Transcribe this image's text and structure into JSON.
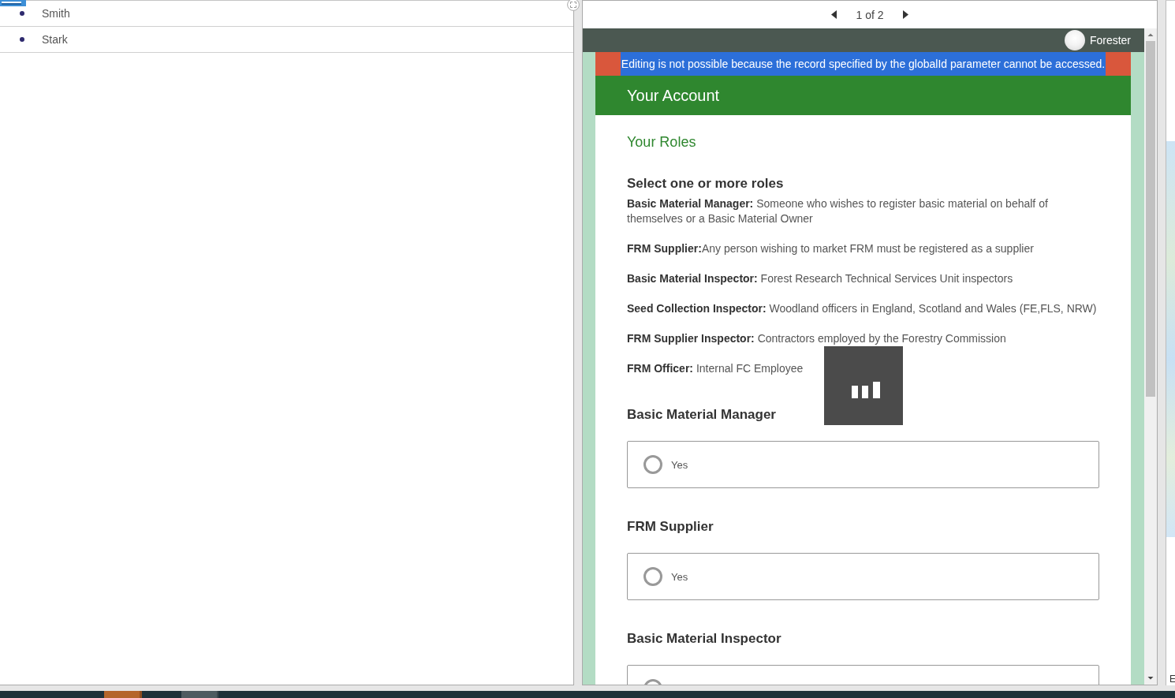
{
  "list_panel": {
    "items": [
      {
        "label": "Smith"
      },
      {
        "label": "Stark"
      }
    ]
  },
  "pager": {
    "text": "1 of 2"
  },
  "form": {
    "header": {
      "user": "Forester"
    },
    "error_banner": {
      "text": "Editing is not possible because the record specified by the globalId parameter cannot be accessed.",
      "highlighted": true
    },
    "title": "Your Account",
    "section_title": "Your Roles",
    "question": "Select one or more roles",
    "role_descriptions": [
      "**Basic Material Manager:** Someone who wishes to register basic material on behalf of themselves or a Basic Material Owner",
      "**FRM Supplier:**Any person wishing to market FRM must be registered as a supplier",
      "**Basic Material Inspector:** Forest Research Technical Services Unit inspectors",
      "**Seed Collection Inspector:** Woodland officers in England, Scotland and Wales (FE,FLS, NRW)",
      "**FRM Supplier Inspector:** Contractors employed by the Forestry Commission",
      "**FRM Officer:** Internal FC Employee"
    ],
    "fields": [
      {
        "label": "Basic Material Manager",
        "options": [
          {
            "label": "Yes",
            "selected": false
          }
        ]
      },
      {
        "label": "FRM Supplier",
        "options": [
          {
            "label": "Yes",
            "selected": false
          }
        ]
      },
      {
        "label": "Basic Material Inspector",
        "options": [
          {
            "selected": false
          }
        ]
      }
    ],
    "loading": true
  },
  "map_panel": {
    "attribution": "E"
  }
}
